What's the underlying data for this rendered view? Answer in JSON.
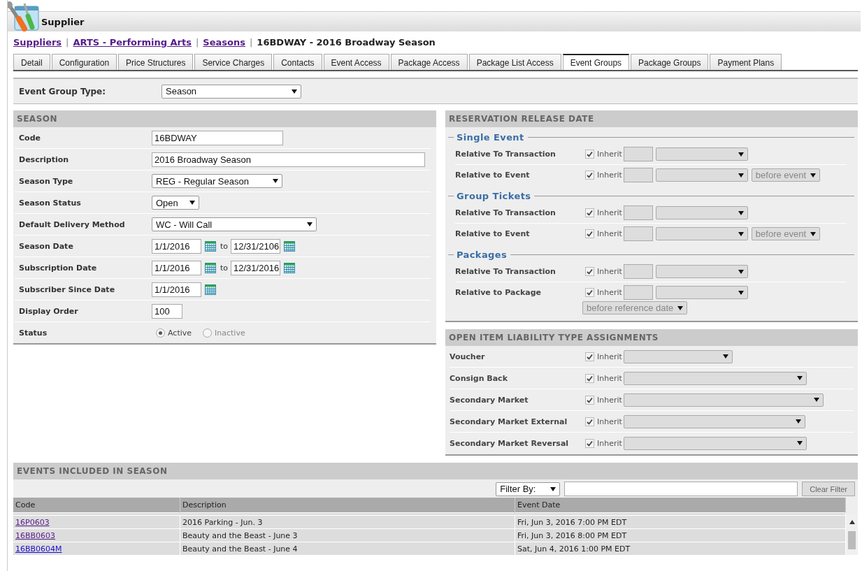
{
  "window": {
    "title": "Supplier"
  },
  "breadcrumb": {
    "links": [
      "Suppliers",
      "ARTS - Performing Arts",
      "Seasons"
    ],
    "separator": "|",
    "current": "16BDWAY - 2016 Broadway Season"
  },
  "tabs": [
    {
      "label": "Detail",
      "selected": false
    },
    {
      "label": "Configuration",
      "selected": false
    },
    {
      "label": "Price Structures",
      "selected": false
    },
    {
      "label": "Service Charges",
      "selected": false
    },
    {
      "label": "Contacts",
      "selected": false
    },
    {
      "label": "Event Access",
      "selected": false
    },
    {
      "label": "Package Access",
      "selected": false
    },
    {
      "label": "Package List Access",
      "selected": false
    },
    {
      "label": "Event Groups",
      "selected": true
    },
    {
      "label": "Package Groups",
      "selected": false
    },
    {
      "label": "Payment Plans",
      "selected": false
    }
  ],
  "event_group_type": {
    "label": "Event Group Type:",
    "value": "Season"
  },
  "season": {
    "title": "SEASON",
    "fields": [
      {
        "kind": "text",
        "label": "Code",
        "value": "16BDWAY"
      },
      {
        "kind": "text",
        "label": "Description",
        "value": "2016 Broadway Season"
      },
      {
        "kind": "select",
        "label": "Season Type",
        "value": "REG - Regular Season"
      },
      {
        "kind": "select",
        "label": "Season Status",
        "value": "Open"
      },
      {
        "kind": "select",
        "label": "Default Delivery Method",
        "value": "WC - Will Call"
      },
      {
        "kind": "range",
        "label": "Season Date",
        "from": "1/1/2016",
        "to_label": "to",
        "to": "12/31/2106"
      },
      {
        "kind": "range",
        "label": "Subscription Date",
        "from": "1/1/2016",
        "to_label": "to",
        "to": "12/31/2016"
      },
      {
        "kind": "date",
        "label": "Subscriber Since Date",
        "value": "1/1/2016"
      },
      {
        "kind": "text",
        "label": "Display Order",
        "value": "100"
      },
      {
        "kind": "radio",
        "label": "Status",
        "options": [
          {
            "label": "Active",
            "selected": true
          },
          {
            "label": "Inactive",
            "selected": false
          }
        ]
      }
    ]
  },
  "reservation": {
    "title": "RESERVATION RELEASE DATE",
    "groups": [
      {
        "title": "Single Event",
        "rows": [
          {
            "label": "Relative To Transaction",
            "inherit_label": "Inherit",
            "inherit": true
          },
          {
            "label": "Relative to Event",
            "inherit_label": "Inherit",
            "inherit": true,
            "direction": "before event",
            "direction_below": false
          }
        ]
      },
      {
        "title": "Group Tickets",
        "rows": [
          {
            "label": "Relative To Transaction",
            "inherit_label": "Inherit",
            "inherit": true
          },
          {
            "label": "Relative to Event",
            "inherit_label": "Inherit",
            "inherit": true,
            "direction": "before event",
            "direction_below": false
          }
        ]
      },
      {
        "title": "Packages",
        "rows": [
          {
            "label": "Relative To Transaction",
            "inherit_label": "Inherit",
            "inherit": true
          },
          {
            "label": "Relative to Package",
            "inherit_label": "Inherit",
            "inherit": true,
            "direction": "before reference date",
            "direction_below": true
          }
        ]
      }
    ]
  },
  "liability": {
    "title": "OPEN ITEM LIABILITY TYPE ASSIGNMENTS",
    "rows": [
      {
        "label": "Voucher",
        "inherit_label": "Inherit",
        "inherit": true
      },
      {
        "label": "Consign Back",
        "inherit_label": "Inherit",
        "inherit": true
      },
      {
        "label": "Secondary Market",
        "inherit_label": "Inherit",
        "inherit": true
      },
      {
        "label": "Secondary Market External",
        "inherit_label": "Inherit",
        "inherit": true
      },
      {
        "label": "Secondary Market Reversal",
        "inherit_label": "Inherit",
        "inherit": true
      }
    ]
  },
  "events": {
    "title": "EVENTS INCLUDED IN SEASON",
    "filter": {
      "value": "Filter By:"
    },
    "clear_button": "Clear Filter",
    "columns": [
      "Code",
      "Description",
      "Event Date"
    ],
    "rows": [
      {
        "code": "16P0603",
        "visited": true,
        "description": "2016 Parking - Jun. 3",
        "date": "Fri, Jun 3, 2016 7:00 PM EDT"
      },
      {
        "code": "16BB0603",
        "visited": true,
        "description": "Beauty and the Beast - June 3",
        "date": "Fri, Jun 3, 2016 8:00 PM EDT"
      },
      {
        "code": "16BB0604M",
        "visited": false,
        "description": "Beauty and the Beast - June 4",
        "date": "Sat, Jun 4, 2016 1:00 PM EDT"
      }
    ]
  }
}
